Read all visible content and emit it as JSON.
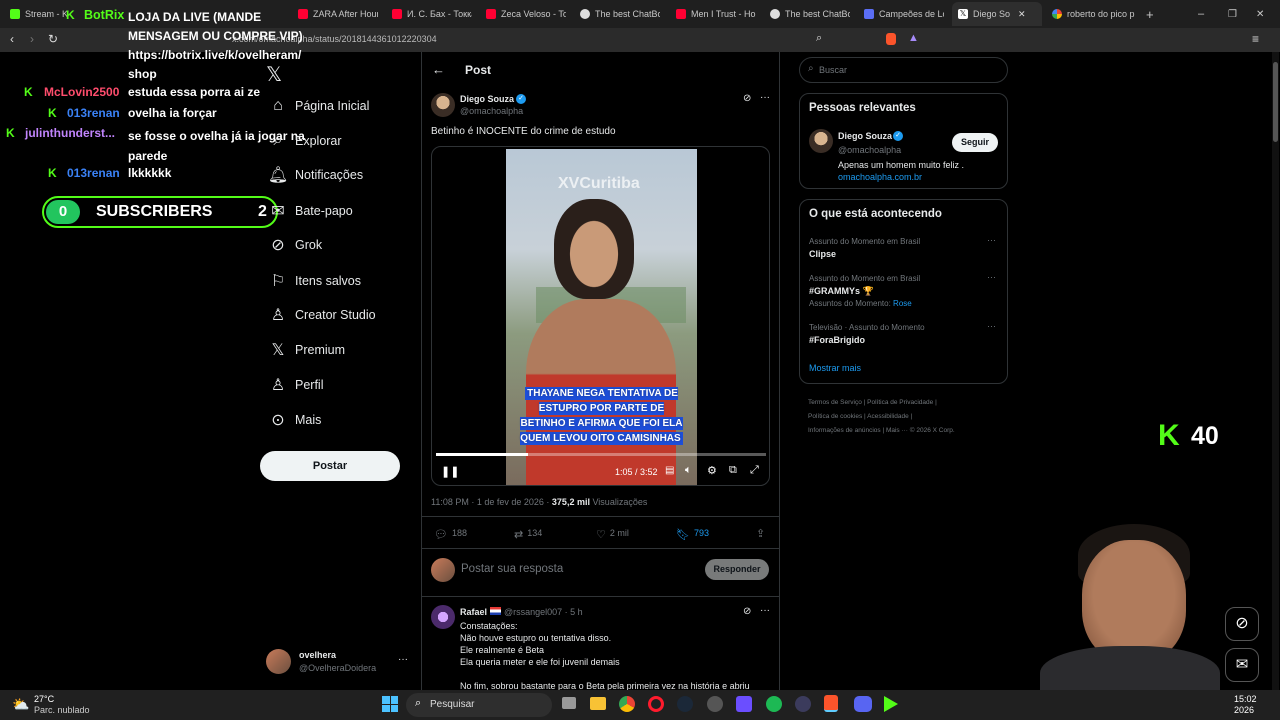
{
  "tabs": [
    {
      "label": "Stream - K"
    },
    {
      "label": "BotRix"
    },
    {
      "label": "ZARA After Hour"
    },
    {
      "label": "И. С. Бах - Токка"
    },
    {
      "label": "Zeca Veloso - To"
    },
    {
      "label": "The best ChatBot"
    },
    {
      "label": "Men I Trust - Hou"
    },
    {
      "label": "The best ChatBot"
    },
    {
      "label": "Campeões de Lol"
    },
    {
      "label": "Diego So"
    },
    {
      "label": "roberto do pico p"
    }
  ],
  "browser": {
    "url": "x.com/omachoalpha/status/2018144361012220304"
  },
  "stream_overlay": {
    "botrix_name": "BotRix",
    "botrix_message": "LOJA DA LIVE (MANDE MENSAGEM OU COMPRE VIP) https://botrix.live/k/ovelheram/ shop",
    "chat": [
      {
        "user": "McLovin2500",
        "text": "estuda essa porra ai ze"
      },
      {
        "user": "013renan",
        "text": "ovelha ia forçar"
      },
      {
        "user": "julinthunderst...",
        "text": "se fosse o ovelha já ia jogar na parede"
      },
      {
        "user": "013renan",
        "text": "lkkkkkk"
      }
    ],
    "subs_count": "0",
    "subs_label": "SUBSCRIBERS",
    "subs_goal": "2",
    "viewer_count": "40"
  },
  "nav": {
    "items": [
      {
        "label": "Página Inicial"
      },
      {
        "label": "Explorar"
      },
      {
        "label": "Notificações"
      },
      {
        "label": "Bate-papo"
      },
      {
        "label": "Grok"
      },
      {
        "label": "Itens salvos"
      },
      {
        "label": "Creator Studio"
      },
      {
        "label": "Premium"
      },
      {
        "label": "Perfil"
      },
      {
        "label": "Mais"
      }
    ],
    "post_button": "Postar",
    "account": {
      "name": "ovelhera",
      "handle": "@OvelheraDoidera"
    }
  },
  "post": {
    "header": "Post",
    "author": "Diego Souza",
    "handle": "@omachoalpha",
    "text": "Betinho é INOCENTE do crime de estudo",
    "video": {
      "watermark": "XVCuritiba",
      "caption": "THAYANE NEGA TENTATIVA DE ESTUPRO POR PARTE DE BETINHO E AFIRMA QUE FOI ELA QUEM LEVOU OITO CAMISINHAS",
      "time": "1:05 / 3:52",
      "progress": 0.28
    },
    "timestamp": "11:08 PM · 1 de fev de 2026 · ",
    "views": "375,2 mil",
    "views_label": "Visualizações",
    "replies": "188",
    "reposts": "134",
    "likes": "2 mil",
    "bookmarks": "793",
    "reply_placeholder": "Postar sua resposta",
    "reply_button": "Responder"
  },
  "reply": {
    "author": "Rafael",
    "handle": "@rssangel007 · 5 h",
    "lines": [
      "Constatações:",
      "Não houve estupro ou tentativa disso.",
      "Ele realmente é Beta",
      "Ela queria meter e ele foi juvenil demais",
      "",
      "No fim, sobrou bastante para o Beta pela primeira vez na história e abriu"
    ]
  },
  "sidebar": {
    "search_placeholder": "Buscar",
    "relevant_title": "Pessoas relevantes",
    "person": {
      "name": "Diego Souza",
      "handle": "@omachoalpha",
      "bio": "Apenas um homem muito feliz .",
      "link": "omachoalpha.com.br",
      "follow": "Seguir"
    },
    "trending_title": "O que está acontecendo",
    "trends": [
      {
        "context": "Assunto do Momento em Brasil",
        "name": "Clipse",
        "extra_label": "",
        "extra_value": ""
      },
      {
        "context": "Assunto do Momento em Brasil",
        "name": "#GRAMMYs",
        "extra_label": "Assuntos do Momento: ",
        "extra_value": "Rose"
      },
      {
        "context": "Televisão · Assunto do Momento",
        "name": "#ForaBrigido",
        "extra_label": "",
        "extra_value": ""
      }
    ],
    "show_more": "Mostrar mais",
    "footer": [
      "Termos de Serviço",
      "Política de Privacidade",
      "Política de cookies",
      "Acessibilidade",
      "Informações de anúncios",
      "Mais ···",
      "© 2026 X Corp."
    ]
  },
  "taskbar": {
    "temp": "27°C",
    "weather": "Parc. nublado",
    "search": "Pesquisar",
    "time": "15:02",
    "date": "2026"
  },
  "colors": {
    "accent": "#1d9bf0",
    "kick": "#53fc18",
    "bg": "#000000"
  }
}
